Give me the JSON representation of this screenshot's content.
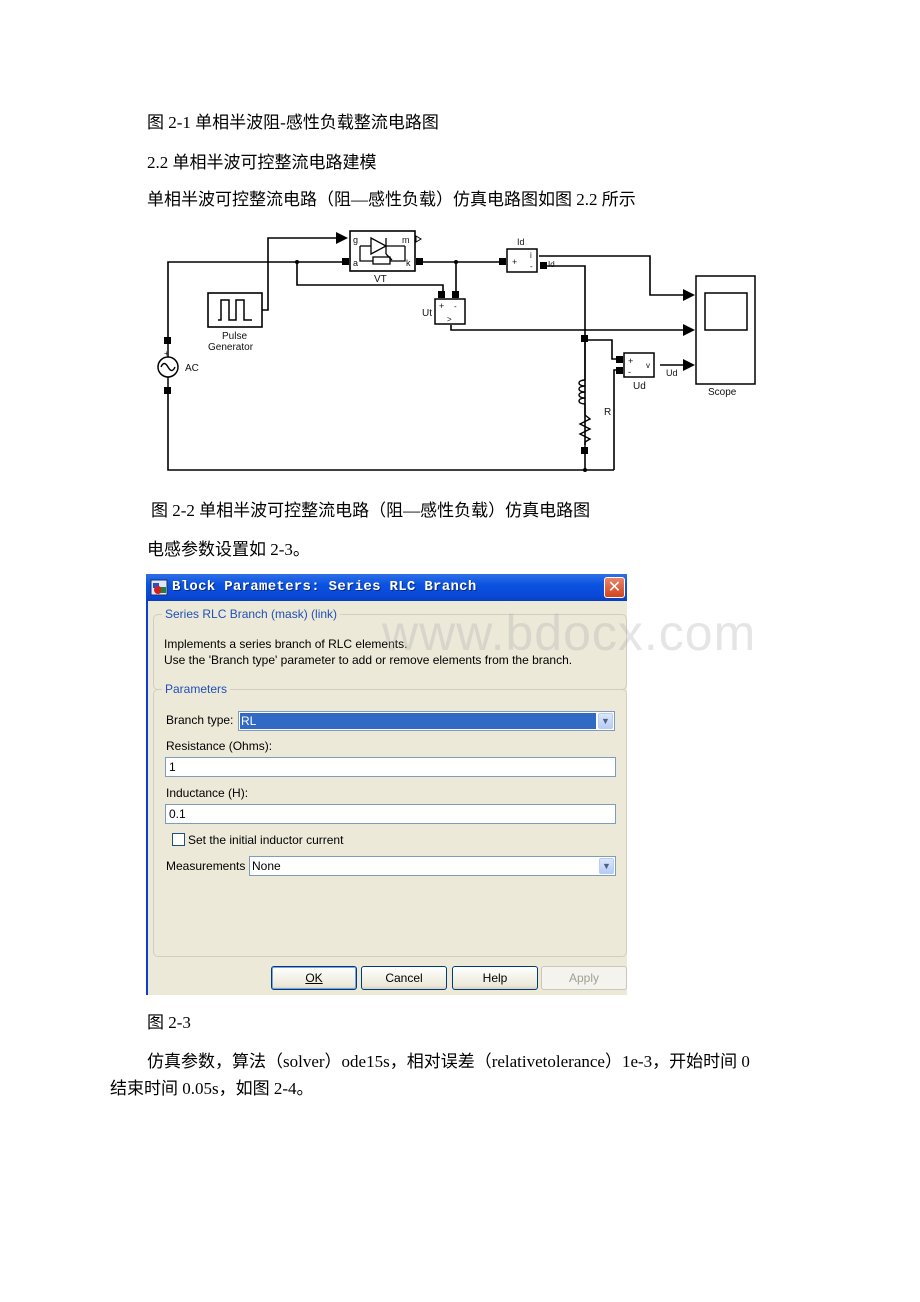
{
  "document": {
    "paragraphs": {
      "fig_2_1_caption": "图 2-1 单相半波阻-感性负载整流电路图",
      "section_2_2_heading": "2.2 单相半波可控整流电路建模",
      "intro_text": "单相半波可控整流电路（阻—感性负载）仿真电路图如图 2.2 所示",
      "fig_2_2_caption": "图 2-2 单相半波可控整流电路（阻—感性负载）仿真电路图",
      "inductance_text": "电感参数设置如 2-3。",
      "fig_2_3_caption": "图 2-3",
      "sim_params_line1": "仿真参数，算法（solver）ode15s，相对误差（relativetolerance）1e-3，开始时间 0",
      "sim_params_line2": "结束时间 0.05s，如图 2-4。"
    },
    "watermark": "www.bdocx.com"
  },
  "circuit": {
    "blocks": {
      "thyristor": {
        "label": "VT",
        "ports": {
          "g": "g",
          "a": "a",
          "m": "m",
          "k": "k"
        }
      },
      "pulse_generator": {
        "label_line1": "Pulse",
        "label_line2": "Generator"
      },
      "ac_source": {
        "label": "AC"
      },
      "current_meter": {
        "label": "Id",
        "port_plus": "+",
        "port_i": "i",
        "port_minus": "-",
        "out_label": "Id"
      },
      "voltage_meter_ut": {
        "label": "Ut",
        "port_plus": "+",
        "port_minus": "-",
        "out": "v"
      },
      "voltage_meter_ud": {
        "label": "Ud",
        "port_plus": "+",
        "port_minus": "-",
        "out": "v",
        "signal_label": "Ud"
      },
      "rl_load": {
        "label": "R"
      },
      "scope": {
        "label": "Scope"
      }
    }
  },
  "dialog": {
    "title": "Block Parameters: Series RLC Branch",
    "close_icon": "close-x-icon",
    "mask_group": {
      "label": "Series RLC Branch (mask) (link)",
      "description_line1": "Implements a series branch of RLC elements.",
      "description_line2": "Use the 'Branch type' parameter to add or remove elements from the branch."
    },
    "params_group": {
      "label": "Parameters",
      "branch_type_label": "Branch type:",
      "branch_type_value": "RL",
      "resistance_label": "Resistance (Ohms):",
      "resistance_value": "1",
      "inductance_label": "Inductance (H):",
      "inductance_value": "0.1",
      "initial_current_checkbox_label": "Set the initial inductor current",
      "initial_current_checked": false,
      "measurements_label": "Measurements",
      "measurements_value": "None"
    },
    "buttons": {
      "ok": "OK",
      "cancel": "Cancel",
      "help": "Help",
      "apply": "Apply"
    }
  }
}
